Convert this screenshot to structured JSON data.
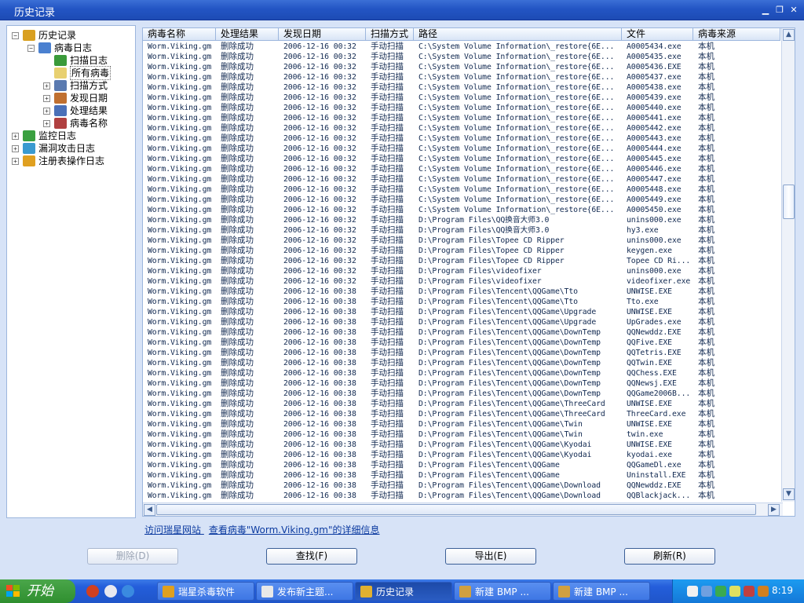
{
  "window": {
    "title": "历史记录"
  },
  "tree": [
    {
      "label": "历史记录",
      "level": 0,
      "expander": "−",
      "icon": "#d9a020",
      "selected": false
    },
    {
      "label": "病毒日志",
      "level": 1,
      "expander": "−",
      "icon": "#4a80d0",
      "selected": false
    },
    {
      "label": "扫描日志",
      "level": 2,
      "expander": "",
      "icon": "#3a9a3a",
      "selected": false
    },
    {
      "label": "所有病毒",
      "level": 2,
      "expander": "",
      "icon": "#e8d070",
      "selected": true
    },
    {
      "label": "扫描方式",
      "level": 2,
      "expander": "+",
      "icon": "#5a7ab0",
      "selected": false
    },
    {
      "label": "发现日期",
      "level": 2,
      "expander": "+",
      "icon": "#c07030",
      "selected": false
    },
    {
      "label": "处理结果",
      "level": 2,
      "expander": "+",
      "icon": "#4a70b8",
      "selected": false
    },
    {
      "label": "病毒名称",
      "level": 2,
      "expander": "+",
      "icon": "#b04040",
      "selected": false
    },
    {
      "label": "监控日志",
      "level": 0,
      "expander": "+",
      "icon": "#3aa040",
      "selected": false
    },
    {
      "label": "漏洞攻击日志",
      "level": 0,
      "expander": "+",
      "icon": "#3a9ad0",
      "selected": false
    },
    {
      "label": "注册表操作日志",
      "level": 0,
      "expander": "+",
      "icon": "#e0a020",
      "selected": false
    }
  ],
  "table": {
    "headers": [
      "病毒名称",
      "处理结果",
      "发现日期",
      "扫描方式",
      "路径",
      "文件",
      "病毒来源"
    ],
    "rows": [
      [
        "Worm.Viking.gm",
        "删除成功",
        "2006-12-16 00:32",
        "手动扫描",
        "C:\\System Volume Information\\_restore{6E...",
        "A0005434.exe",
        "本机"
      ],
      [
        "Worm.Viking.gm",
        "删除成功",
        "2006-12-16 00:32",
        "手动扫描",
        "C:\\System Volume Information\\_restore{6E...",
        "A0005435.exe",
        "本机"
      ],
      [
        "Worm.Viking.gm",
        "删除成功",
        "2006-12-16 00:32",
        "手动扫描",
        "C:\\System Volume Information\\_restore{6E...",
        "A0005436.EXE",
        "本机"
      ],
      [
        "Worm.Viking.gm",
        "删除成功",
        "2006-12-16 00:32",
        "手动扫描",
        "C:\\System Volume Information\\_restore{6E...",
        "A0005437.exe",
        "本机"
      ],
      [
        "Worm.Viking.gm",
        "删除成功",
        "2006-12-16 00:32",
        "手动扫描",
        "C:\\System Volume Information\\_restore{6E...",
        "A0005438.exe",
        "本机"
      ],
      [
        "Worm.Viking.gm",
        "删除成功",
        "2006-12-16 00:32",
        "手动扫描",
        "C:\\System Volume Information\\_restore{6E...",
        "A0005439.exe",
        "本机"
      ],
      [
        "Worm.Viking.gm",
        "删除成功",
        "2006-12-16 00:32",
        "手动扫描",
        "C:\\System Volume Information\\_restore{6E...",
        "A0005440.exe",
        "本机"
      ],
      [
        "Worm.Viking.gm",
        "删除成功",
        "2006-12-16 00:32",
        "手动扫描",
        "C:\\System Volume Information\\_restore{6E...",
        "A0005441.exe",
        "本机"
      ],
      [
        "Worm.Viking.gm",
        "删除成功",
        "2006-12-16 00:32",
        "手动扫描",
        "C:\\System Volume Information\\_restore{6E...",
        "A0005442.exe",
        "本机"
      ],
      [
        "Worm.Viking.gm",
        "删除成功",
        "2006-12-16 00:32",
        "手动扫描",
        "C:\\System Volume Information\\_restore{6E...",
        "A0005443.exe",
        "本机"
      ],
      [
        "Worm.Viking.gm",
        "删除成功",
        "2006-12-16 00:32",
        "手动扫描",
        "C:\\System Volume Information\\_restore{6E...",
        "A0005444.exe",
        "本机"
      ],
      [
        "Worm.Viking.gm",
        "删除成功",
        "2006-12-16 00:32",
        "手动扫描",
        "C:\\System Volume Information\\_restore{6E...",
        "A0005445.exe",
        "本机"
      ],
      [
        "Worm.Viking.gm",
        "删除成功",
        "2006-12-16 00:32",
        "手动扫描",
        "C:\\System Volume Information\\_restore{6E...",
        "A0005446.exe",
        "本机"
      ],
      [
        "Worm.Viking.gm",
        "删除成功",
        "2006-12-16 00:32",
        "手动扫描",
        "C:\\System Volume Information\\_restore{6E...",
        "A0005447.exe",
        "本机"
      ],
      [
        "Worm.Viking.gm",
        "删除成功",
        "2006-12-16 00:32",
        "手动扫描",
        "C:\\System Volume Information\\_restore{6E...",
        "A0005448.exe",
        "本机"
      ],
      [
        "Worm.Viking.gm",
        "删除成功",
        "2006-12-16 00:32",
        "手动扫描",
        "C:\\System Volume Information\\_restore{6E...",
        "A0005449.exe",
        "本机"
      ],
      [
        "Worm.Viking.gm",
        "删除成功",
        "2006-12-16 00:32",
        "手动扫描",
        "C:\\System Volume Information\\_restore{6E...",
        "A0005450.exe",
        "本机"
      ],
      [
        "Worm.Viking.gm",
        "删除成功",
        "2006-12-16 00:32",
        "手动扫描",
        "D:\\Program Files\\QQ换音大师3.0",
        "unins000.exe",
        "本机"
      ],
      [
        "Worm.Viking.gm",
        "删除成功",
        "2006-12-16 00:32",
        "手动扫描",
        "D:\\Program Files\\QQ换音大师3.0",
        "hy3.exe",
        "本机"
      ],
      [
        "Worm.Viking.gm",
        "删除成功",
        "2006-12-16 00:32",
        "手动扫描",
        "D:\\Program Files\\Topee CD Ripper",
        "unins000.exe",
        "本机"
      ],
      [
        "Worm.Viking.gm",
        "删除成功",
        "2006-12-16 00:32",
        "手动扫描",
        "D:\\Program Files\\Topee CD Ripper",
        "keygen.exe",
        "本机"
      ],
      [
        "Worm.Viking.gm",
        "删除成功",
        "2006-12-16 00:32",
        "手动扫描",
        "D:\\Program Files\\Topee CD Ripper",
        "Topee CD Ri...",
        "本机"
      ],
      [
        "Worm.Viking.gm",
        "删除成功",
        "2006-12-16 00:32",
        "手动扫描",
        "D:\\Program Files\\videofixer",
        "unins000.exe",
        "本机"
      ],
      [
        "Worm.Viking.gm",
        "删除成功",
        "2006-12-16 00:32",
        "手动扫描",
        "D:\\Program Files\\videofixer",
        "videofixer.exe",
        "本机"
      ],
      [
        "Worm.Viking.gm",
        "删除成功",
        "2006-12-16 00:38",
        "手动扫描",
        "D:\\Program Files\\Tencent\\QQGame\\Tto",
        "UNWISE.EXE",
        "本机"
      ],
      [
        "Worm.Viking.gm",
        "删除成功",
        "2006-12-16 00:38",
        "手动扫描",
        "D:\\Program Files\\Tencent\\QQGame\\Tto",
        "Tto.exe",
        "本机"
      ],
      [
        "Worm.Viking.gm",
        "删除成功",
        "2006-12-16 00:38",
        "手动扫描",
        "D:\\Program Files\\Tencent\\QQGame\\Upgrade",
        "UNWISE.EXE",
        "本机"
      ],
      [
        "Worm.Viking.gm",
        "删除成功",
        "2006-12-16 00:38",
        "手动扫描",
        "D:\\Program Files\\Tencent\\QQGame\\Upgrade",
        "UpGrades.exe",
        "本机"
      ],
      [
        "Worm.Viking.gm",
        "删除成功",
        "2006-12-16 00:38",
        "手动扫描",
        "D:\\Program Files\\Tencent\\QQGame\\DownTemp",
        "QQNewddz.EXE",
        "本机"
      ],
      [
        "Worm.Viking.gm",
        "删除成功",
        "2006-12-16 00:38",
        "手动扫描",
        "D:\\Program Files\\Tencent\\QQGame\\DownTemp",
        "QQFive.EXE",
        "本机"
      ],
      [
        "Worm.Viking.gm",
        "删除成功",
        "2006-12-16 00:38",
        "手动扫描",
        "D:\\Program Files\\Tencent\\QQGame\\DownTemp",
        "QQTetris.EXE",
        "本机"
      ],
      [
        "Worm.Viking.gm",
        "删除成功",
        "2006-12-16 00:38",
        "手动扫描",
        "D:\\Program Files\\Tencent\\QQGame\\DownTemp",
        "QQTwin.EXE",
        "本机"
      ],
      [
        "Worm.Viking.gm",
        "删除成功",
        "2006-12-16 00:38",
        "手动扫描",
        "D:\\Program Files\\Tencent\\QQGame\\DownTemp",
        "QQChess.EXE",
        "本机"
      ],
      [
        "Worm.Viking.gm",
        "删除成功",
        "2006-12-16 00:38",
        "手动扫描",
        "D:\\Program Files\\Tencent\\QQGame\\DownTemp",
        "QQNewsj.EXE",
        "本机"
      ],
      [
        "Worm.Viking.gm",
        "删除成功",
        "2006-12-16 00:38",
        "手动扫描",
        "D:\\Program Files\\Tencent\\QQGame\\DownTemp",
        "QQGame2006B...",
        "本机"
      ],
      [
        "Worm.Viking.gm",
        "删除成功",
        "2006-12-16 00:38",
        "手动扫描",
        "D:\\Program Files\\Tencent\\QQGame\\ThreeCard",
        "UNWISE.EXE",
        "本机"
      ],
      [
        "Worm.Viking.gm",
        "删除成功",
        "2006-12-16 00:38",
        "手动扫描",
        "D:\\Program Files\\Tencent\\QQGame\\ThreeCard",
        "ThreeCard.exe",
        "本机"
      ],
      [
        "Worm.Viking.gm",
        "删除成功",
        "2006-12-16 00:38",
        "手动扫描",
        "D:\\Program Files\\Tencent\\QQGame\\Twin",
        "UNWISE.EXE",
        "本机"
      ],
      [
        "Worm.Viking.gm",
        "删除成功",
        "2006-12-16 00:38",
        "手动扫描",
        "D:\\Program Files\\Tencent\\QQGame\\Twin",
        "twin.exe",
        "本机"
      ],
      [
        "Worm.Viking.gm",
        "删除成功",
        "2006-12-16 00:38",
        "手动扫描",
        "D:\\Program Files\\Tencent\\QQGame\\Kyodai",
        "UNWISE.EXE",
        "本机"
      ],
      [
        "Worm.Viking.gm",
        "删除成功",
        "2006-12-16 00:38",
        "手动扫描",
        "D:\\Program Files\\Tencent\\QQGame\\Kyodai",
        "kyodai.exe",
        "本机"
      ],
      [
        "Worm.Viking.gm",
        "删除成功",
        "2006-12-16 00:38",
        "手动扫描",
        "D:\\Program Files\\Tencent\\QQGame",
        "QQGameDl.exe",
        "本机"
      ],
      [
        "Worm.Viking.gm",
        "删除成功",
        "2006-12-16 00:38",
        "手动扫描",
        "D:\\Program Files\\Tencent\\QQGame",
        "Uninstall.EXE",
        "本机"
      ],
      [
        "Worm.Viking.gm",
        "删除成功",
        "2006-12-16 00:38",
        "手动扫描",
        "D:\\Program Files\\Tencent\\QQGame\\Download",
        "QQNewddz.EXE",
        "本机"
      ],
      [
        "Worm.Viking.gm",
        "删除成功",
        "2006-12-16 00:38",
        "手动扫描",
        "D:\\Program Files\\Tencent\\QQGame\\Download",
        "QQBlackjack...",
        "本机"
      ]
    ]
  },
  "links": {
    "visit_site": "访问瑞星网站",
    "view_virus": "查看病毒\"Worm.Viking.gm\"的详细信息"
  },
  "buttons": {
    "delete": "删除(D)",
    "find": "查找(F)",
    "export": "导出(E)",
    "refresh": "刷新(R)"
  },
  "taskbar": {
    "start_label": "开始",
    "tasks": [
      "瑞星杀毒软件",
      "发布新主题...",
      "历史记录",
      "新建 BMP ...",
      "新建 BMP ..."
    ],
    "active_index": 2,
    "clock": "8:19"
  },
  "colors": {
    "titlebar": "#2355c4",
    "link": "#0b3aa0",
    "taskbar": "#245edb",
    "start": "#2f8f2f"
  }
}
